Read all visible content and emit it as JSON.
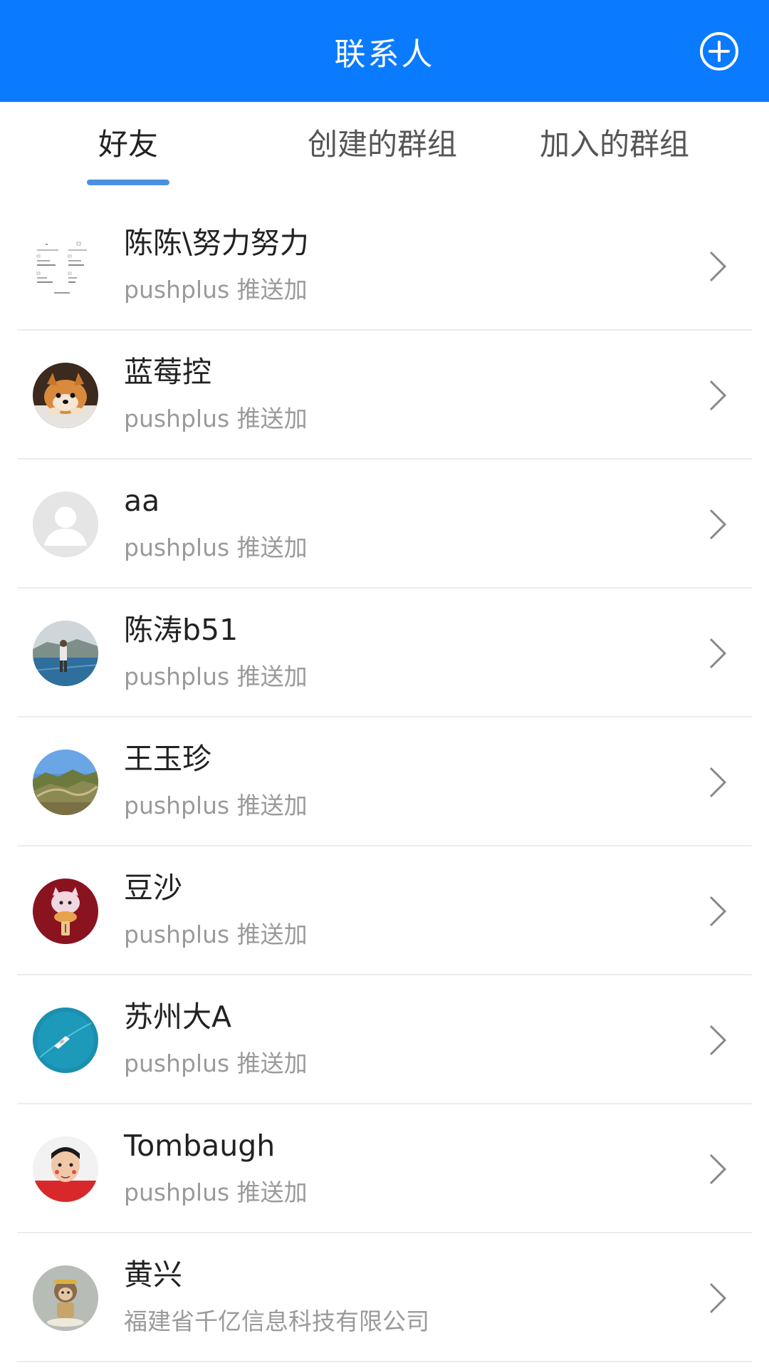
{
  "header": {
    "title": "联系人",
    "add_icon": "plus-circle-icon"
  },
  "tabs": [
    {
      "label": "好友",
      "active": true
    },
    {
      "label": "创建的群组",
      "active": false
    },
    {
      "label": "加入的群组",
      "active": false
    }
  ],
  "colors": {
    "header_bg": "#0a7aff",
    "tab_indicator": "#4a90e2",
    "subtitle": "#9a9a9a"
  },
  "contacts": [
    {
      "name": "陈陈\\努力努力",
      "subtitle": "pushplus 推送加",
      "avatar": "screenshot-thumbnail"
    },
    {
      "name": "蓝莓控",
      "subtitle": "pushplus 推送加",
      "avatar": "dog-photo"
    },
    {
      "name": "aa",
      "subtitle": "pushplus 推送加",
      "avatar": "default-user-icon"
    },
    {
      "name": "陈涛b51",
      "subtitle": "pushplus 推送加",
      "avatar": "person-on-track-photo"
    },
    {
      "name": "王玉珍",
      "subtitle": "pushplus 推送加",
      "avatar": "great-wall-landscape-photo"
    },
    {
      "name": "豆沙",
      "subtitle": "pushplus 推送加",
      "avatar": "cartoon-cat-lantern-photo"
    },
    {
      "name": "苏州大A",
      "subtitle": "pushplus 推送加",
      "avatar": "boat-on-sea-photo"
    },
    {
      "name": "Tombaugh",
      "subtitle": "pushplus 推送加",
      "avatar": "child-portrait-photo"
    },
    {
      "name": "黄兴",
      "subtitle": "福建省千亿信息科技有限公司",
      "avatar": "monkey-king-figure-photo"
    }
  ]
}
